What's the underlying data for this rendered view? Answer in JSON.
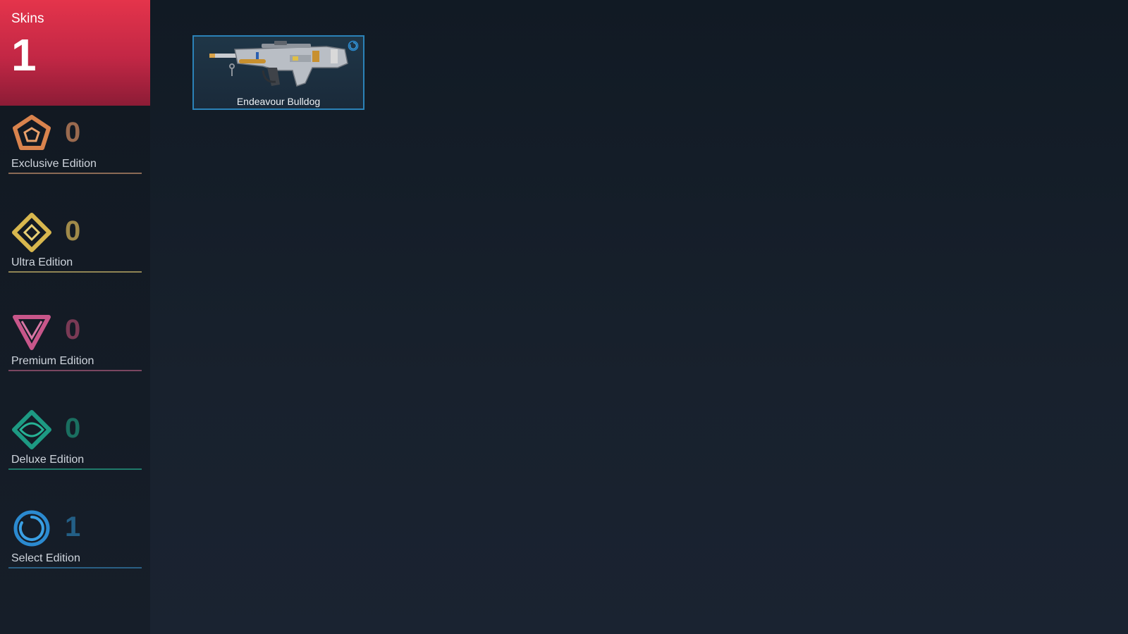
{
  "summary": {
    "label": "Skins",
    "count": "1"
  },
  "editions": [
    {
      "label": "Exclusive Edition",
      "count": "0",
      "icon": "exclusive-edition-icon",
      "color": "#d9834d"
    },
    {
      "label": "Ultra Edition",
      "count": "0",
      "icon": "ultra-edition-icon",
      "color": "#d8b74e"
    },
    {
      "label": "Premium Edition",
      "count": "0",
      "icon": "premium-edition-icon",
      "color": "#c8568a"
    },
    {
      "label": "Deluxe Edition",
      "count": "0",
      "icon": "deluxe-edition-icon",
      "color": "#1d9a83"
    },
    {
      "label": "Select Edition",
      "count": "1",
      "icon": "select-edition-icon",
      "color": "#2b8ad0"
    }
  ],
  "skins": [
    {
      "name": "Endeavour Bulldog",
      "icon": "rifle-icon",
      "tier": "select-edition-icon"
    }
  ]
}
